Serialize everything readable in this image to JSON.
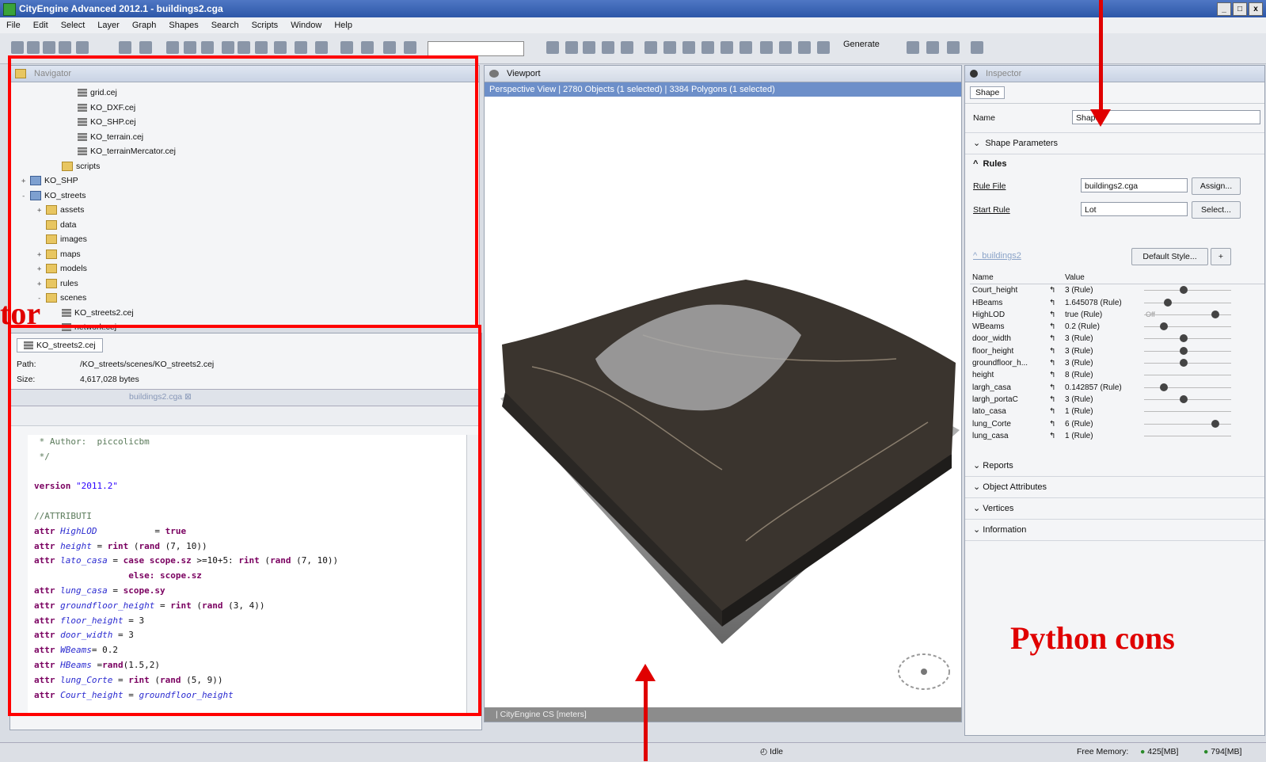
{
  "window": {
    "title": "CityEngine Advanced 2012.1 - buildings2.cga",
    "min": "_",
    "max": "□",
    "close": "x"
  },
  "menu": [
    "File",
    "Edit",
    "Select",
    "Layer",
    "Graph",
    "Shapes",
    "Search",
    "Scripts",
    "Window",
    "Help"
  ],
  "toolbar": {
    "generate_label": "Generate"
  },
  "navigator": {
    "tab": "Navigator",
    "items": [
      {
        "label": "grid.cej",
        "type": "file",
        "indent": 3
      },
      {
        "label": "KO_DXF.cej",
        "type": "file",
        "indent": 3
      },
      {
        "label": "KO_SHP.cej",
        "type": "file",
        "indent": 3
      },
      {
        "label": "KO_terrain.cej",
        "type": "file",
        "indent": 3
      },
      {
        "label": "KO_terrainMercator.cej",
        "type": "file",
        "indent": 3
      },
      {
        "label": "scripts",
        "type": "folder",
        "indent": 2
      },
      {
        "label": "KO_SHP",
        "type": "proj",
        "indent": 0,
        "expander": "+"
      },
      {
        "label": "KO_streets",
        "type": "proj",
        "indent": 0,
        "expander": "-"
      },
      {
        "label": "assets",
        "type": "folder",
        "indent": 1,
        "expander": "+"
      },
      {
        "label": "data",
        "type": "folder",
        "indent": 1
      },
      {
        "label": "images",
        "type": "folder",
        "indent": 1
      },
      {
        "label": "maps",
        "type": "folder",
        "indent": 1,
        "expander": "+"
      },
      {
        "label": "models",
        "type": "folder",
        "indent": 1,
        "expander": "+"
      },
      {
        "label": "rules",
        "type": "folder",
        "indent": 1,
        "expander": "+"
      },
      {
        "label": "scenes",
        "type": "folder",
        "indent": 1,
        "expander": "-"
      },
      {
        "label": "KO_streets2.cej",
        "type": "file",
        "indent": 2
      },
      {
        "label": "network.cej",
        "type": "file",
        "indent": 2
      }
    ]
  },
  "fileinfo": {
    "tab": "KO_streets2.cej",
    "path_label": "Path:",
    "path": "/KO_streets/scenes/KO_streets2.cej",
    "size_label": "Size:",
    "size": "4,617,028 bytes"
  },
  "editor": {
    "tab": "buildings2.cga",
    "lines": [
      [
        {
          "t": " * Author:  piccolicbm",
          "c": "cm"
        }
      ],
      [
        {
          "t": " */",
          "c": "cm"
        }
      ],
      [
        {
          "t": "",
          "c": ""
        }
      ],
      [
        {
          "t": "version ",
          "c": "kw"
        },
        {
          "t": "\"2011.2\"",
          "c": "st"
        }
      ],
      [
        {
          "t": "",
          "c": ""
        }
      ],
      [
        {
          "t": "//ATTRIBUTI",
          "c": "cm"
        }
      ],
      [
        {
          "t": "attr ",
          "c": "kw"
        },
        {
          "t": "HighLOD",
          "c": "it"
        },
        {
          "t": "           = ",
          "c": ""
        },
        {
          "t": "true",
          "c": "kw"
        }
      ],
      [
        {
          "t": "attr ",
          "c": "kw"
        },
        {
          "t": "height",
          "c": "it"
        },
        {
          "t": " = ",
          "c": ""
        },
        {
          "t": "rint",
          "c": "kw"
        },
        {
          "t": " (",
          "c": ""
        },
        {
          "t": "rand",
          "c": "kw"
        },
        {
          "t": " (7, 10))",
          "c": ""
        }
      ],
      [
        {
          "t": "attr ",
          "c": "kw"
        },
        {
          "t": "lato_casa",
          "c": "it"
        },
        {
          "t": " = ",
          "c": ""
        },
        {
          "t": "case scope.sz",
          "c": "kw"
        },
        {
          "t": " >=10+5: ",
          "c": ""
        },
        {
          "t": "rint",
          "c": "kw"
        },
        {
          "t": " (",
          "c": ""
        },
        {
          "t": "rand",
          "c": "kw"
        },
        {
          "t": " (7, 10))",
          "c": ""
        }
      ],
      [
        {
          "t": "                  ",
          "c": ""
        },
        {
          "t": "else: scope.sz",
          "c": "kw"
        }
      ],
      [
        {
          "t": "attr ",
          "c": "kw"
        },
        {
          "t": "lung_casa",
          "c": "it"
        },
        {
          "t": " = ",
          "c": ""
        },
        {
          "t": "scope.sy",
          "c": "kw"
        }
      ],
      [
        {
          "t": "attr ",
          "c": "kw"
        },
        {
          "t": "groundfloor_height",
          "c": "it"
        },
        {
          "t": " = ",
          "c": ""
        },
        {
          "t": "rint",
          "c": "kw"
        },
        {
          "t": " (",
          "c": ""
        },
        {
          "t": "rand",
          "c": "kw"
        },
        {
          "t": " (3, 4))",
          "c": ""
        }
      ],
      [
        {
          "t": "attr ",
          "c": "kw"
        },
        {
          "t": "floor_height",
          "c": "it"
        },
        {
          "t": " = 3",
          "c": ""
        }
      ],
      [
        {
          "t": "attr ",
          "c": "kw"
        },
        {
          "t": "door_width",
          "c": "it"
        },
        {
          "t": " = 3",
          "c": ""
        }
      ],
      [
        {
          "t": "attr ",
          "c": "kw"
        },
        {
          "t": "WBeams",
          "c": "it"
        },
        {
          "t": "= 0.2",
          "c": ""
        }
      ],
      [
        {
          "t": "attr ",
          "c": "kw"
        },
        {
          "t": "HBeams",
          "c": "it"
        },
        {
          "t": " =",
          "c": ""
        },
        {
          "t": "rand",
          "c": "kw"
        },
        {
          "t": "(1.5,2)",
          "c": ""
        }
      ],
      [
        {
          "t": "attr ",
          "c": "kw"
        },
        {
          "t": "lung_Corte",
          "c": "it"
        },
        {
          "t": " = ",
          "c": ""
        },
        {
          "t": "rint",
          "c": "kw"
        },
        {
          "t": " (",
          "c": ""
        },
        {
          "t": "rand",
          "c": "kw"
        },
        {
          "t": " (5, 9))",
          "c": ""
        }
      ],
      [
        {
          "t": "attr ",
          "c": "kw"
        },
        {
          "t": "Court_height",
          "c": "it"
        },
        {
          "t": " = ",
          "c": ""
        },
        {
          "t": "groundfloor_height",
          "c": "it"
        }
      ]
    ]
  },
  "viewport": {
    "tab": "Viewport",
    "info": "Perspective View  |  2780 Objects  (1 selected)  |  3384 Polygons  (1 selected)",
    "status": "|   CityEngine CS [meters]"
  },
  "inspector": {
    "tab": "Inspector",
    "subtab": "Shape",
    "name_label": "Name",
    "name_value": "Shape",
    "shape_params": "Shape Parameters",
    "rules": "Rules",
    "rule_file_label": "Rule File",
    "rule_file": "buildings2.cga",
    "assign": "Assign...",
    "start_rule_label": "Start Rule",
    "start_rule": "Lot",
    "select": "Select...",
    "group": "buildings2",
    "default_style": "Default Style...",
    "col_name": "Name",
    "col_value": "Value",
    "off_label": "Off",
    "params": [
      {
        "name": "Court_height",
        "value": "3 (Rule)",
        "slider": 0.45
      },
      {
        "name": "HBeams",
        "value": "1.645078 (Rule)",
        "slider": 0.25
      },
      {
        "name": "HighLOD",
        "value": "true (Rule)",
        "slider": 0.85,
        "toggle": true
      },
      {
        "name": "WBeams",
        "value": "0.2 (Rule)",
        "slider": 0.2
      },
      {
        "name": "door_width",
        "value": "3 (Rule)",
        "slider": 0.45
      },
      {
        "name": "floor_height",
        "value": "3 (Rule)",
        "slider": 0.45
      },
      {
        "name": "groundfloor_h...",
        "value": "3 (Rule)",
        "slider": 0.45
      },
      {
        "name": "height",
        "value": "8 (Rule)",
        "slider": null
      },
      {
        "name": "largh_casa",
        "value": "0.142857 (Rule)",
        "slider": 0.2
      },
      {
        "name": "largh_portaC",
        "value": "3 (Rule)",
        "slider": 0.45
      },
      {
        "name": "lato_casa",
        "value": "1 (Rule)",
        "slider": null
      },
      {
        "name": "lung_Corte",
        "value": "6 (Rule)",
        "slider": 0.85
      },
      {
        "name": "lung_casa",
        "value": "1 (Rule)",
        "slider": null
      }
    ],
    "sections": [
      "Reports",
      "Object Attributes",
      "Vertices",
      "Information"
    ]
  },
  "statusbar": {
    "state": "Idle",
    "free_memory_label": "Free Memory:",
    "mem1": "425[MB]",
    "mem2": "794[MB]"
  },
  "overlay": {
    "left_text": "tor",
    "right_text": "Python cons"
  },
  "colors": {
    "annotation": "#ff0000",
    "viewport_info": "#6d8fc9"
  }
}
